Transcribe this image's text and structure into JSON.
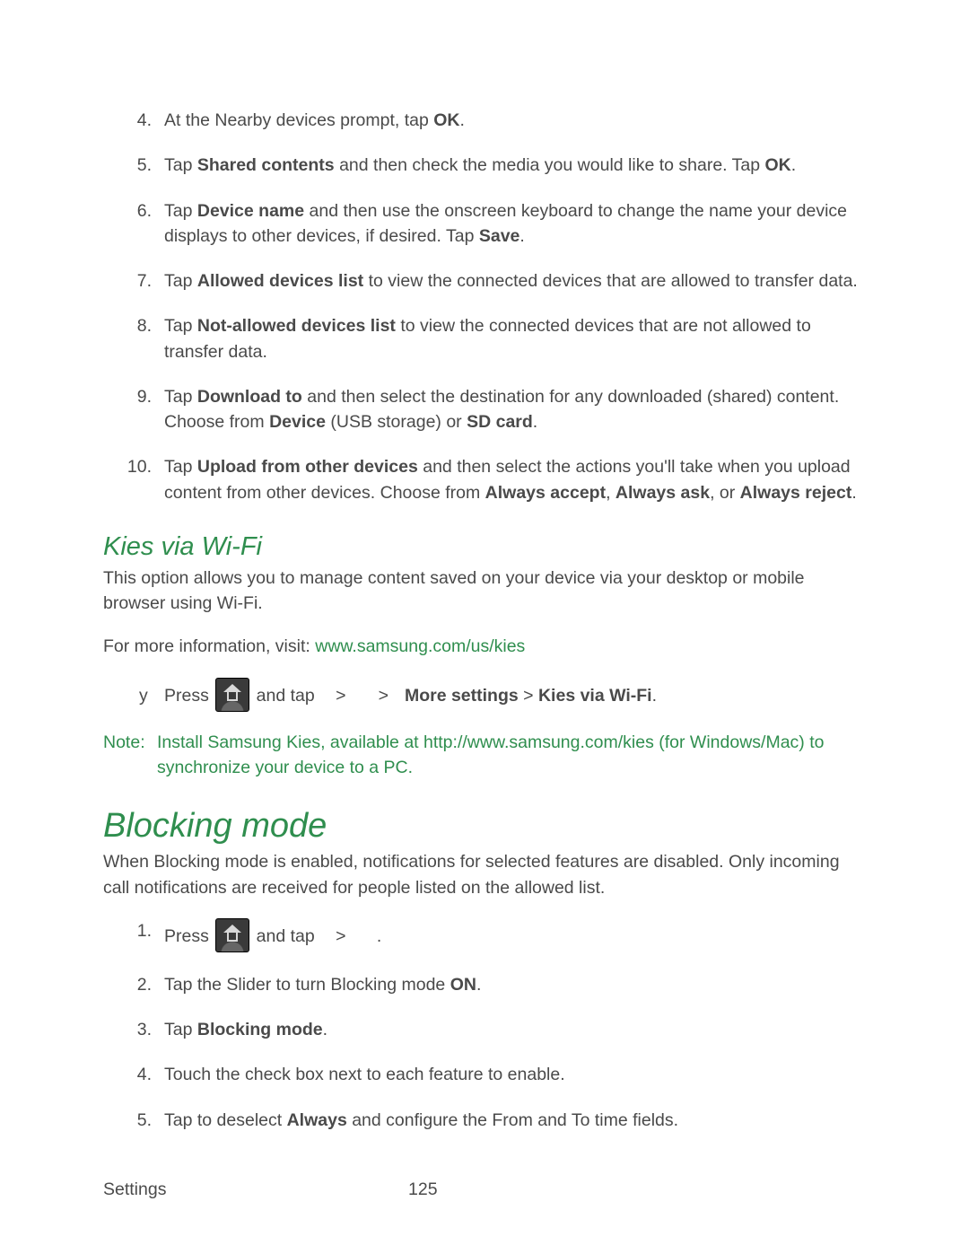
{
  "list1": [
    {
      "n": "4.",
      "pre": "At the Nearby devices prompt, tap ",
      "b1": "OK",
      "post": "."
    },
    {
      "n": "5.",
      "pre": "Tap ",
      "b1": "Shared contents",
      "mid": " and then check the media you would like to share. Tap ",
      "b2": "OK",
      "post": "."
    },
    {
      "n": "6.",
      "pre": "Tap ",
      "b1": "Device name",
      "mid": " and then use the onscreen keyboard to change the name your device displays to other devices, if desired. Tap ",
      "b2": "Save",
      "post": "."
    },
    {
      "n": "7.",
      "pre": "Tap ",
      "b1": "Allowed devices list",
      "mid": " to view the connected devices that are allowed to transfer data.",
      "b2": "",
      "post": ""
    },
    {
      "n": "8.",
      "pre": "Tap ",
      "b1": "Not-allowed devices list",
      "mid": " to view the connected devices that are not allowed to transfer data.",
      "b2": "",
      "post": ""
    }
  ],
  "item9": {
    "n": "9.",
    "pre": "Tap ",
    "b1": "Download to",
    "mid": " and then select the destination for any downloaded (shared) content. Choose from ",
    "b2": "Device",
    "mid2": " (USB storage) or ",
    "b3": "SD card",
    "post": "."
  },
  "item10": {
    "n": "10.",
    "pre": "Tap ",
    "b1": "Upload from other devices",
    "mid": " and then select the actions you'll take when you upload content from other devices. Choose from ",
    "b2": "Always accept",
    "mid2": ", ",
    "b3": "Always ask",
    "mid3": ", or ",
    "b4": "Always reject",
    "post": "."
  },
  "kies": {
    "heading": "Kies via Wi-Fi",
    "intro": "This option allows you to manage content saved on your device via your desktop or mobile browser using Wi-Fi.",
    "info_pre": "For more information, visit: ",
    "info_link": "www.samsung.com/us/kies",
    "bullet_mark": "y",
    "bl_pre": "Press ",
    "bl_mid": " and tap ",
    "gt": ">",
    "bl_b1": "More settings",
    "bl_b2": "Kies via Wi-Fi",
    "dot": ".",
    "note_label": "Note",
    "note_colon": ":",
    "note_pre": "Install Samsung Kies, available at ",
    "note_link": "http://www.samsung.com/kies (for Windows/Mac) to synchronize your device to a PC."
  },
  "blocking": {
    "heading": "Blocking mode",
    "intro": "When Blocking mode is enabled, notifications for selected features are disabled. Only incoming call notifications are received for people listed on the allowed list.",
    "s1_n": "1.",
    "s1_pre": "Press ",
    "s1_mid": " and tap ",
    "s1_gt": ">",
    "s1_dot": ".",
    "s2_n": "2.",
    "s2_pre": "Tap the Slider to turn Blocking mode ",
    "s2_b": "ON",
    "s2_post": ".",
    "s3_n": "3.",
    "s3_pre": "Tap ",
    "s3_b": "Blocking mode",
    "s3_post": ".",
    "s4_n": "4.",
    "s4_text": "Touch the check box next to each feature to enable.",
    "s5_n": "5.",
    "s5_pre": "Tap to deselect  ",
    "s5_b": "Always",
    "s5_post": " and configure the From and To time fields."
  },
  "footer": {
    "section": "Settings",
    "page": "125"
  }
}
